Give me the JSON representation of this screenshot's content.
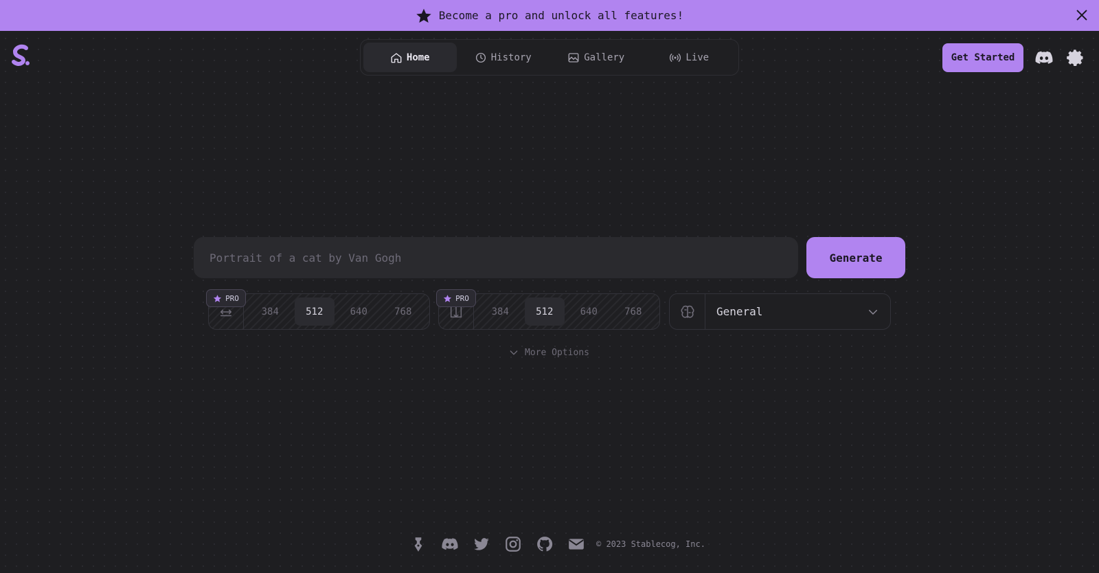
{
  "banner": {
    "text": "Become a pro and unlock all features!",
    "icon": "star-icon",
    "close_icon": "close-icon"
  },
  "colors": {
    "accent": "#b184f0",
    "background": "#1e1e21",
    "banner_bg": "#b184f0"
  },
  "nav": {
    "items": [
      {
        "label": "Home",
        "icon": "home-icon",
        "active": true
      },
      {
        "label": "History",
        "icon": "history-icon",
        "active": false
      },
      {
        "label": "Gallery",
        "icon": "gallery-icon",
        "active": false
      },
      {
        "label": "Live",
        "icon": "live-icon",
        "active": false
      }
    ]
  },
  "header": {
    "cta_label": "Get Started",
    "icons": [
      "discord-icon",
      "gear-icon"
    ]
  },
  "prompt": {
    "placeholder": "Portrait of a cat by Van Gogh",
    "value": ""
  },
  "generate_label": "Generate",
  "width_selector": {
    "badge": "PRO",
    "options": [
      "384",
      "512",
      "640",
      "768"
    ],
    "selected": "512",
    "icon": "width-icon"
  },
  "height_selector": {
    "badge": "PRO",
    "options": [
      "384",
      "512",
      "640",
      "768"
    ],
    "selected": "512",
    "icon": "height-icon"
  },
  "model_selector": {
    "value": "General",
    "icon": "brain-icon"
  },
  "more_options_label": "More Options",
  "footer": {
    "icons": [
      "pen-icon",
      "discord-icon",
      "twitter-icon",
      "instagram-icon",
      "github-icon",
      "mail-icon"
    ],
    "copyright": "© 2023 Stablecog, Inc."
  }
}
